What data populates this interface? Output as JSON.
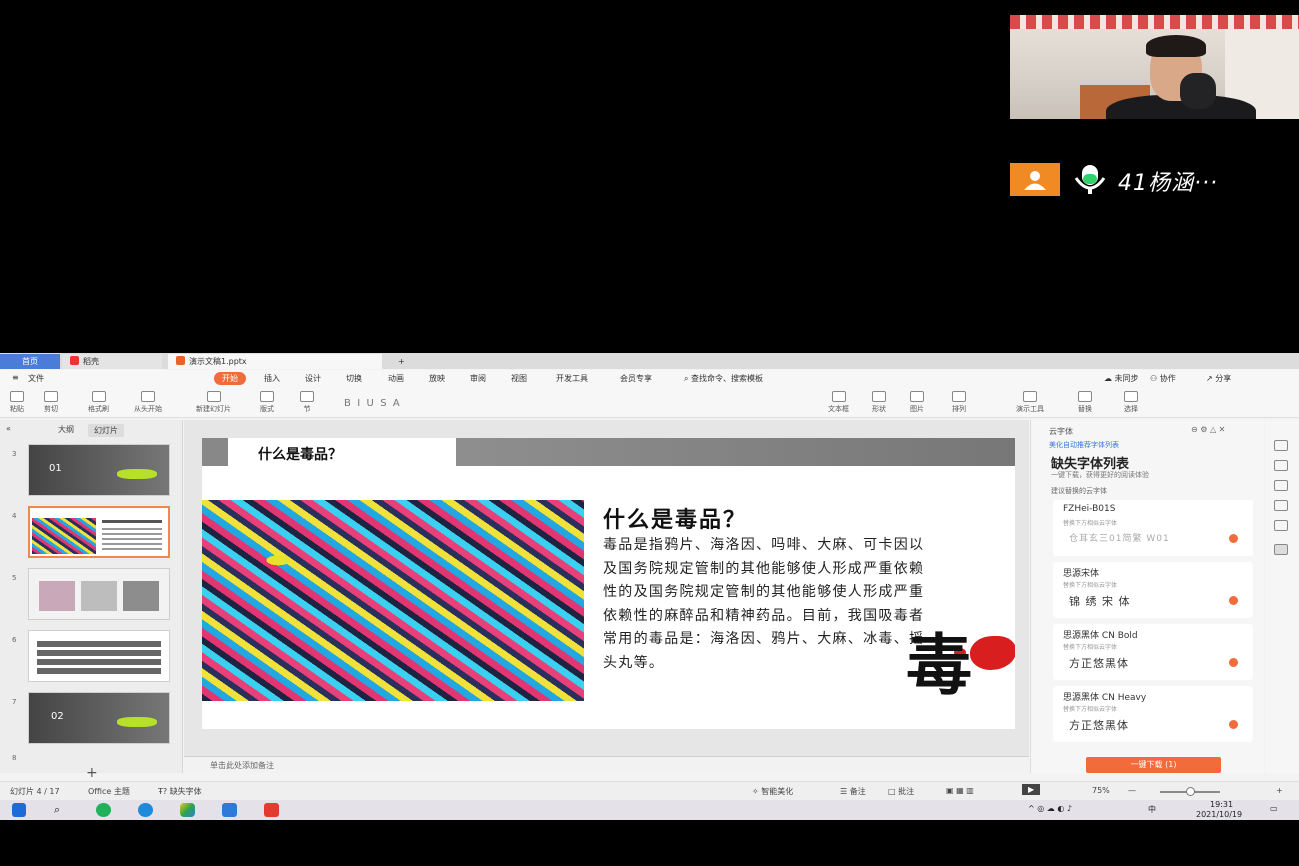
{
  "overlay": {
    "speaker_name": "41杨涵···"
  },
  "window": {
    "tabs": {
      "home": "首页",
      "store": "稻壳",
      "doc": "演示文稿1.pptx"
    },
    "menus": [
      "文件",
      "开始",
      "插入",
      "设计",
      "切换",
      "动画",
      "放映",
      "审阅",
      "视图",
      "开发工具",
      "会员专享"
    ],
    "search_placeholder": "查找命令、搜索模板",
    "sync": "未同步",
    "collab": "协作",
    "share": "分享",
    "ribbon": [
      "粘贴",
      "剪切",
      "格式刷",
      "从头开始",
      "新建幻灯片",
      "版式",
      "节",
      "文本框",
      "形状",
      "图片",
      "排列",
      "演示工具",
      "替换",
      "选择"
    ]
  },
  "thumbs": {
    "tabs": {
      "outline": "大纲",
      "slides": "幻灯片"
    },
    "items": [
      {
        "num": "3"
      },
      {
        "num": "4"
      },
      {
        "num": "5"
      },
      {
        "num": "6"
      },
      {
        "num": "7"
      },
      {
        "num": "8"
      }
    ]
  },
  "slide": {
    "header": "什么是毒品？",
    "title": "什么是毒品？",
    "body": "毒品是指鸦片、海洛因、吗啡、大麻、可卡因以及国务院规定管制的其他能够使人形成严重依赖性的及国务院规定管制的其他能够使人形成严重依赖性的麻醉品和精神药品。目前，我国吸毒者常用的毒品是：海洛因、鸦片、大麻、冰毒、摇头丸等。",
    "calligraphy": "毒",
    "notes_placeholder": "单击此处添加备注"
  },
  "panel": {
    "header": "云字体",
    "link": "美化自动推荐字体列表",
    "title": "缺失字体列表",
    "subtitle": "一键下载，获得更好的阅读体验",
    "section": "建议替换的云字体",
    "fonts": [
      {
        "name": "FZHei-B01S",
        "tip": "替换下方相似云字体",
        "preview": "仓耳玄三01简繁 W01"
      },
      {
        "name": "思源宋体",
        "tip": "替换下方相似云字体",
        "preview": "锦 绣 宋 体"
      },
      {
        "name": "思源黑体 CN Bold",
        "tip": "替换下方相似云字体",
        "preview": "方正悠黑体"
      },
      {
        "name": "思源黑体 CN Heavy",
        "tip": "替换下方相似云字体",
        "preview": "方正悠黑体"
      }
    ],
    "download_button": "一键下载 (1)"
  },
  "status": {
    "slide_count": "幻灯片 4 / 17",
    "theme": "Office 主题",
    "missing_font": "缺失字体",
    "beautify": "智能美化",
    "notes": "备注",
    "comments": "批注",
    "zoom": "75%"
  },
  "taskbar": {
    "time": "19:31",
    "date": "2021/10/19",
    "lang": "中"
  }
}
